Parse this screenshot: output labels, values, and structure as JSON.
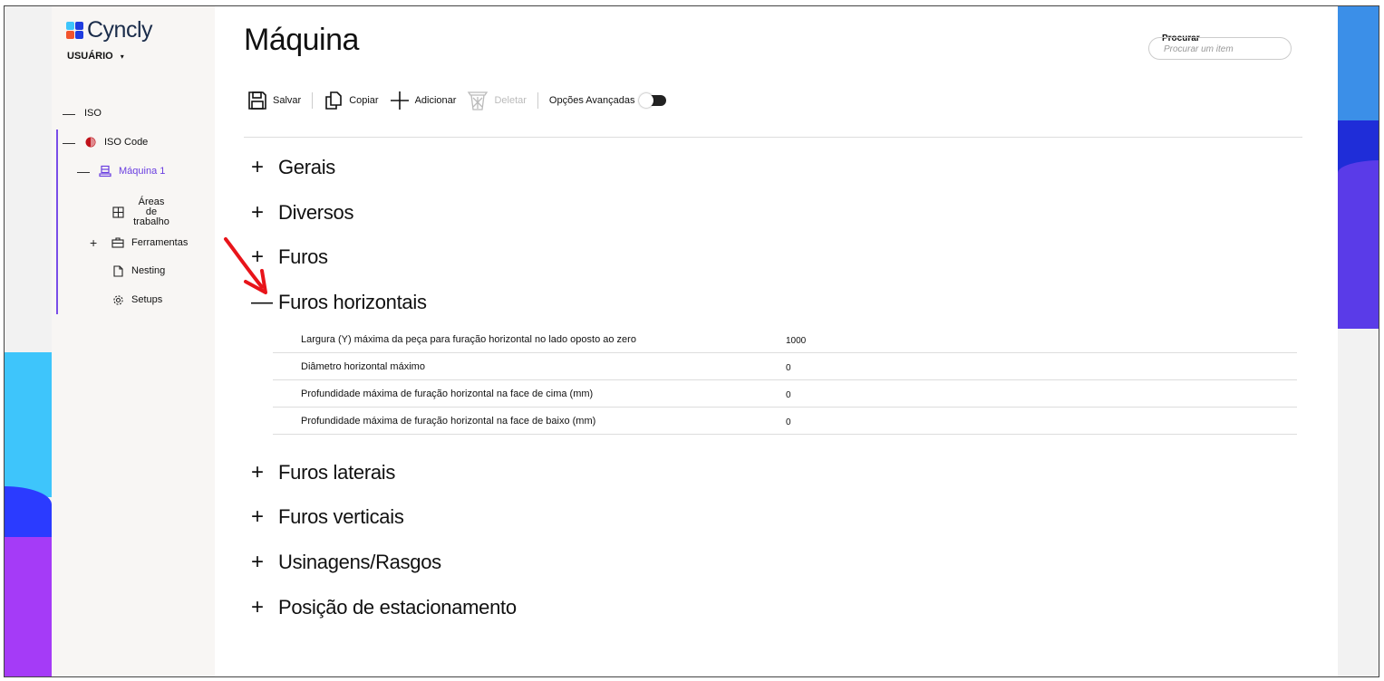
{
  "brand": {
    "name": "Cyncly",
    "colors": [
      "#f2542d",
      "#3ec5fb",
      "#1f3de0",
      "#7a4ee8"
    ]
  },
  "user": {
    "label": "USUÁRIO",
    "caret": "▾"
  },
  "tree": [
    {
      "toggle": "—",
      "label": "ISO",
      "icon": ""
    },
    {
      "toggle": "—",
      "label": "ISO Code",
      "icon": "iso-code-icon"
    },
    {
      "toggle": "—",
      "label": "Máquina 1",
      "icon": "machine-icon",
      "active": true
    },
    {
      "toggle": "",
      "label": "Áreas de trabalho",
      "icon": "grid-icon"
    },
    {
      "toggle": "+",
      "label": "Ferramentas",
      "icon": "toolbox-icon"
    },
    {
      "toggle": "",
      "label": "Nesting",
      "icon": "page-icon"
    },
    {
      "toggle": "",
      "label": "Setups",
      "icon": "gear-icon"
    }
  ],
  "page": {
    "title": "Máquina"
  },
  "search": {
    "label": "Procurar",
    "placeholder": "Procurar um item"
  },
  "toolbar": {
    "save": "Salvar",
    "copy": "Copiar",
    "add": "Adicionar",
    "delete": "Deletar",
    "advanced": "Opções Avançadas",
    "advanced_on": false
  },
  "sections": [
    {
      "sign": "+",
      "label": "Gerais"
    },
    {
      "sign": "+",
      "label": "Diversos"
    },
    {
      "sign": "+",
      "label": "Furos"
    },
    {
      "sign": "—",
      "label": "Furos horizontais"
    },
    {
      "sign": "+",
      "label": "Furos laterais"
    },
    {
      "sign": "+",
      "label": "Furos verticais"
    },
    {
      "sign": "+",
      "label": "Usinagens/Rasgos"
    },
    {
      "sign": "+",
      "label": "Posição de estacionamento"
    }
  ],
  "rows": [
    {
      "label": "Largura (Y) máxima da peça para furação horizontal no lado oposto ao zero",
      "value": "1000"
    },
    {
      "label": "Diâmetro horizontal máximo",
      "value": "0"
    },
    {
      "label": "Profundidade máxima de furação horizontal na face de cima (mm)",
      "value": "0"
    },
    {
      "label": "Profundidade máxima de furação horizontal na face de baixo (mm)",
      "value": "0"
    }
  ],
  "annotation": {
    "arrow_color": "#e8141a"
  }
}
